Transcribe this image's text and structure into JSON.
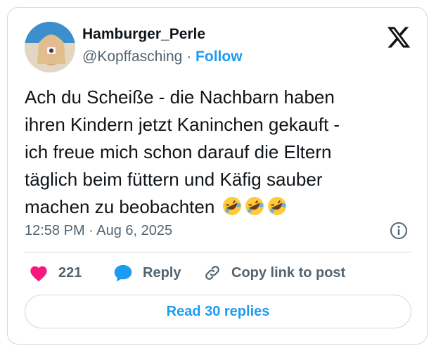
{
  "user": {
    "display_name": "Hamburger_Perle",
    "handle": "@Kopffasching",
    "separator": "·",
    "follow_label": "Follow"
  },
  "tweet": {
    "text_line1": "Ach du Scheiße - die Nachbarn haben",
    "text_line2": "ihren Kindern jetzt Kaninchen gekauft -",
    "text_line3": "ich freue mich schon darauf die Eltern",
    "text_line4": "täglich beim füttern und Käfig sauber",
    "text_line5": "machen zu beobachten",
    "emoji": [
      "rolling-on-floor-laughing-emoji",
      "rolling-on-floor-laughing-emoji",
      "rolling-on-floor-laughing-emoji"
    ],
    "timestamp": "12:58 PM · Aug 6, 2025"
  },
  "actions": {
    "likes_count": "221",
    "reply_label": "Reply",
    "copy_label": "Copy link to post"
  },
  "read_replies_label": "Read 30 replies",
  "colors": {
    "accent": "#1d9bf0",
    "like": "#f91880",
    "text": "#0f1419",
    "muted": "#536471",
    "border": "#cfd9de"
  }
}
